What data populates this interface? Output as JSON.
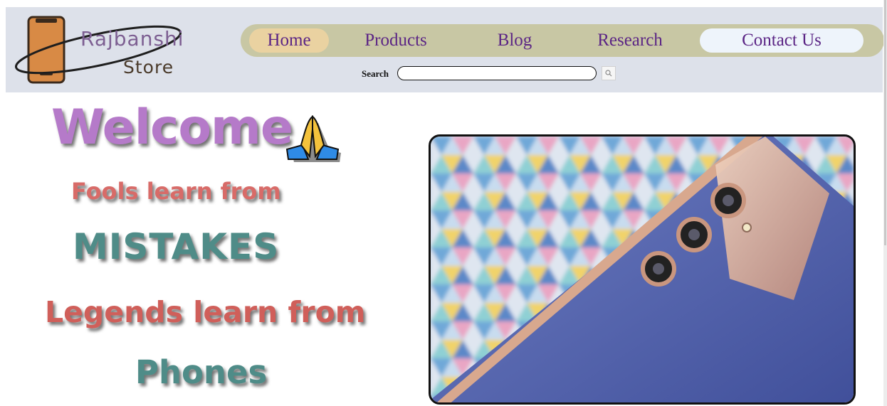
{
  "logo": {
    "name_top": "Rajbanshi",
    "name_bottom": "Store"
  },
  "nav": {
    "items": [
      {
        "label": "Home"
      },
      {
        "label": "Products"
      },
      {
        "label": "Blog"
      },
      {
        "label": "Research"
      },
      {
        "label": "Contact Us"
      }
    ]
  },
  "search": {
    "label": "Search",
    "value": "",
    "placeholder": ""
  },
  "hero": {
    "welcome": "Welcome",
    "line1": "Fools learn from",
    "line2": "MISTAKES",
    "line3": "Legends learn from",
    "line4": "Phones"
  },
  "icons": {
    "welcome_emoji": "folded-hands-icon",
    "search_button": "search-icon"
  },
  "colors": {
    "header_bg": "#dde1ea",
    "nav_bg": "#c8c7a4",
    "nav_text": "#5b2585",
    "home_highlight": "#ead2a1",
    "contact_highlight": "#eef4fb"
  }
}
